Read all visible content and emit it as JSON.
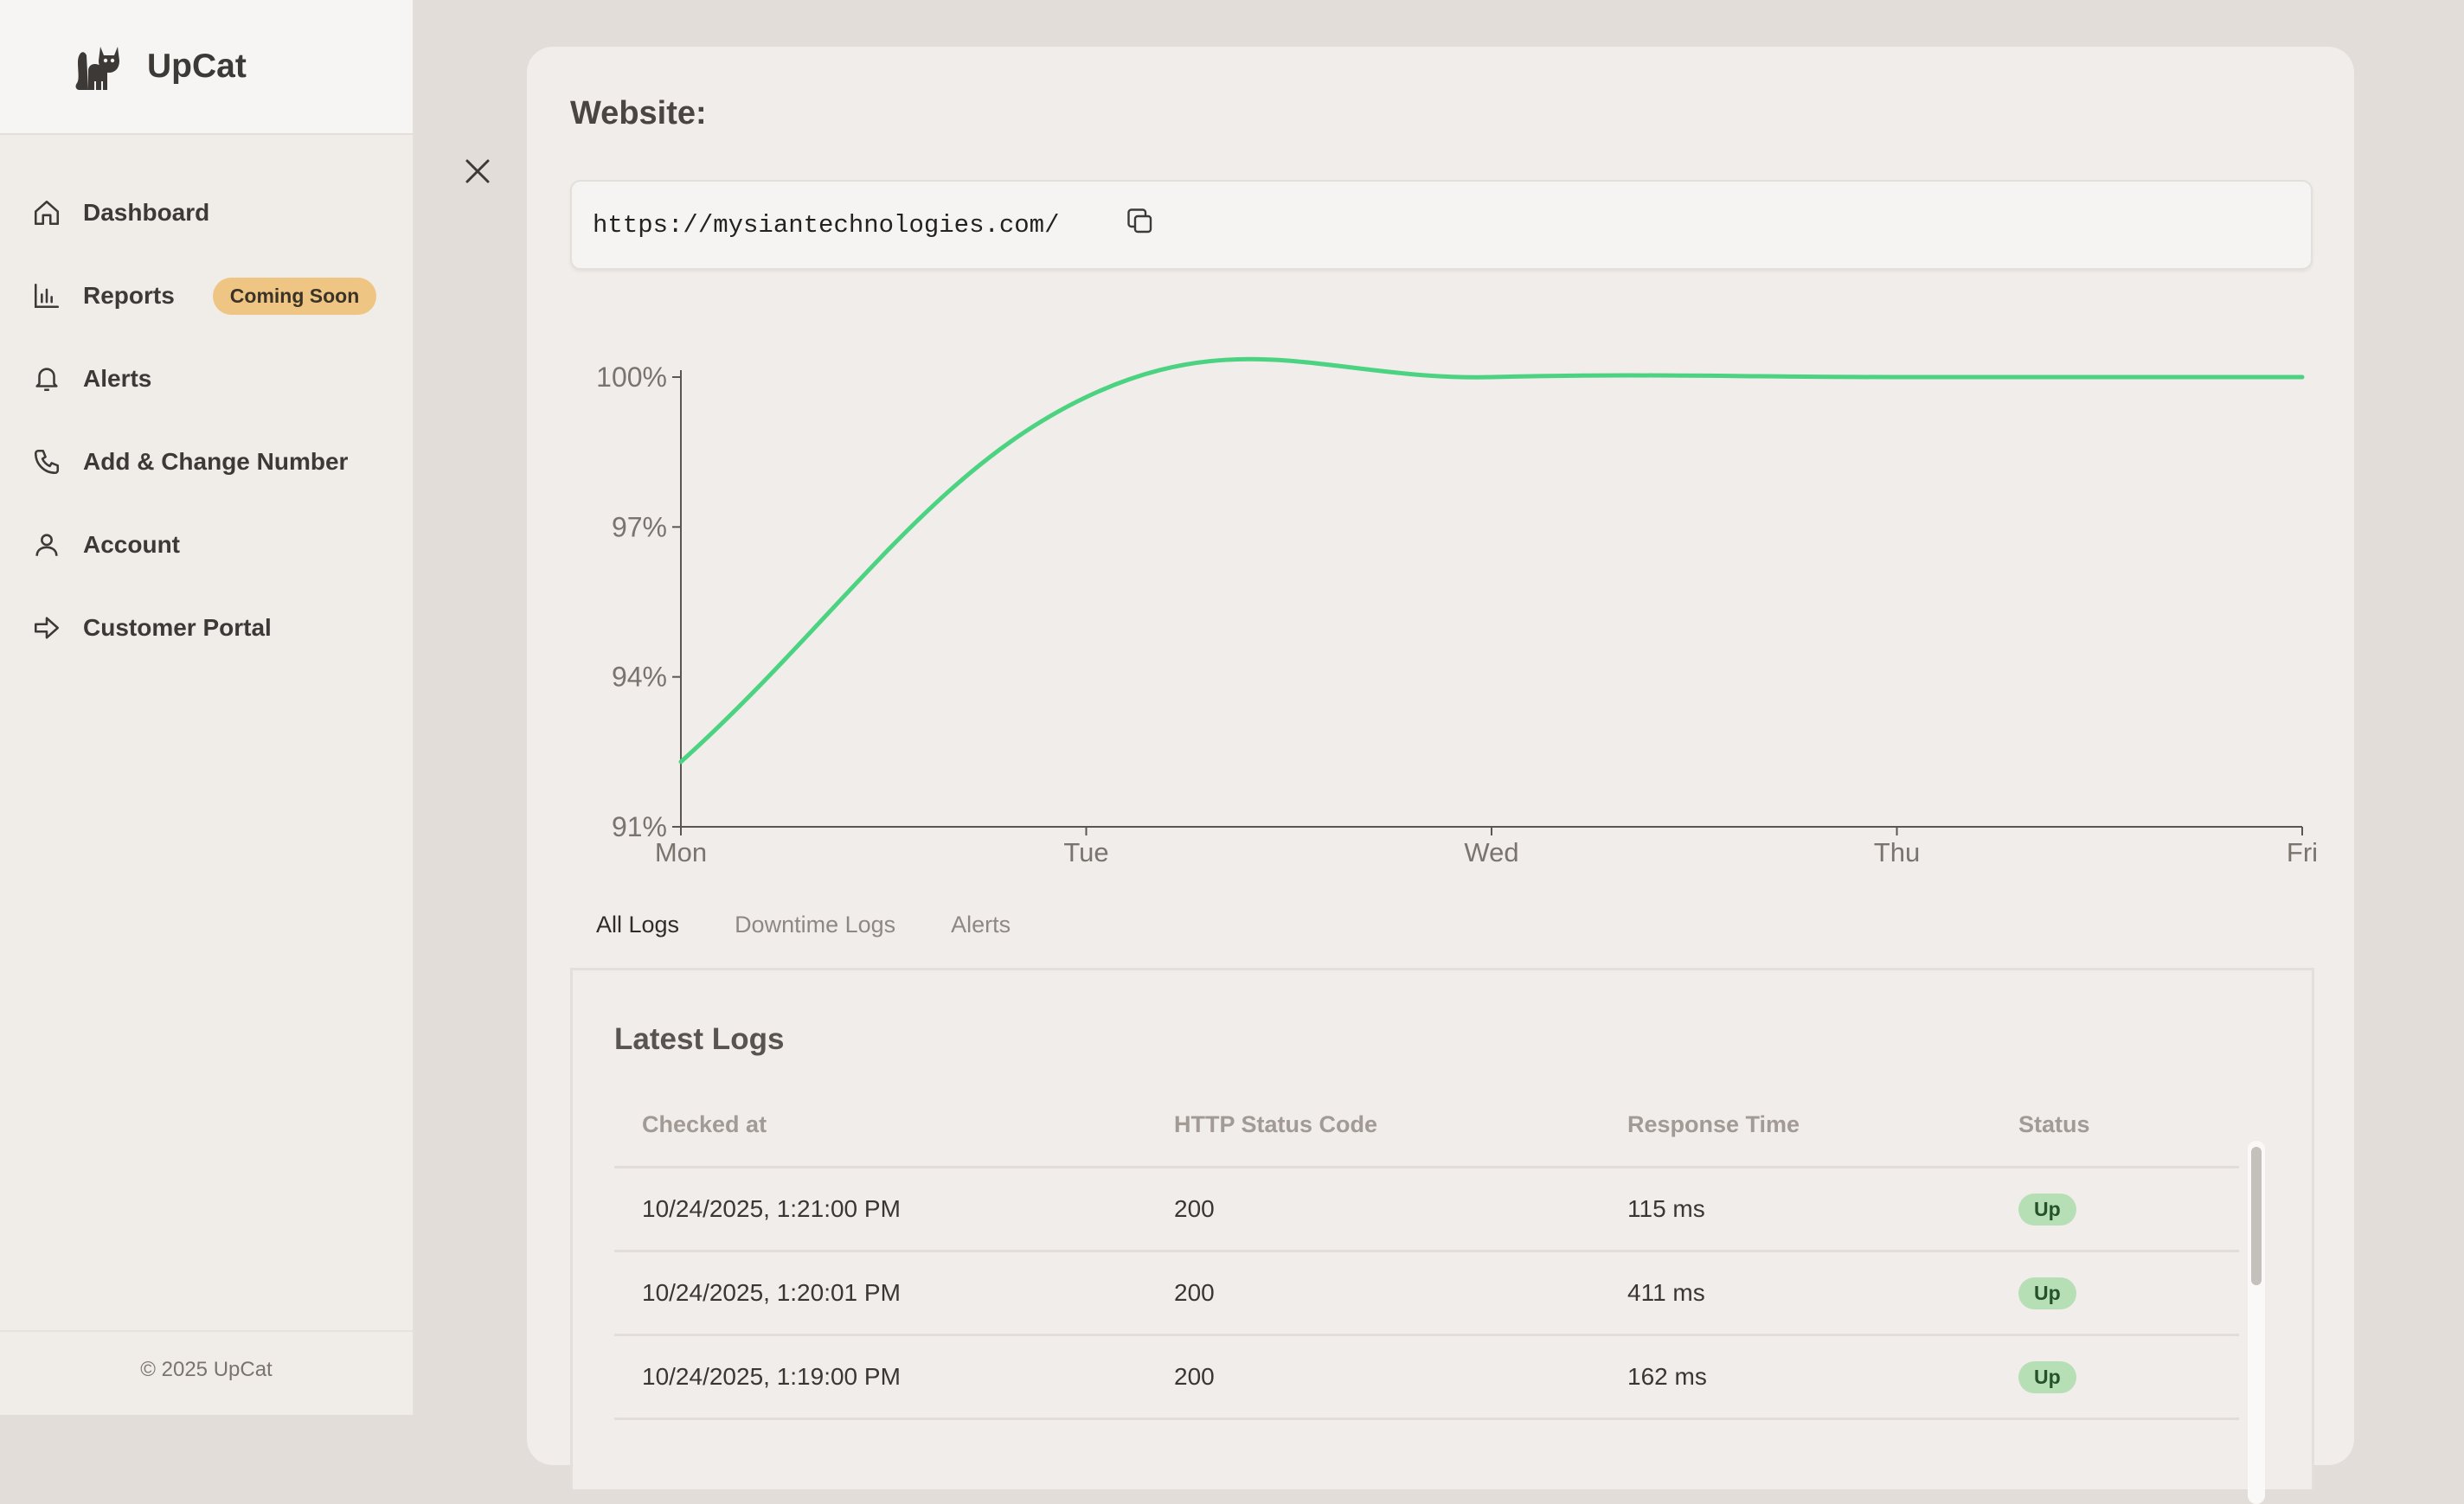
{
  "brand": {
    "name": "UpCat",
    "logo_icon": "cat-logo-icon"
  },
  "sidebar": {
    "items": [
      {
        "label": "Dashboard",
        "icon": "home-icon"
      },
      {
        "label": "Reports",
        "icon": "bar-chart-icon",
        "badge": "Coming Soon"
      },
      {
        "label": "Alerts",
        "icon": "bell-icon"
      },
      {
        "label": "Add & Change Number",
        "icon": "phone-icon"
      },
      {
        "label": "Account",
        "icon": "user-icon"
      },
      {
        "label": "Customer Portal",
        "icon": "arrow-right-icon"
      }
    ],
    "footer": "© 2025 UpCat"
  },
  "panel": {
    "title": "Website:",
    "url": "https://mysiantechnologies.com/",
    "close_icon": "close-icon",
    "copy_icon": "copy-icon"
  },
  "chart_data": {
    "type": "line",
    "x": [
      "Mon",
      "Tue",
      "Wed",
      "Thu",
      "Fri"
    ],
    "series": [
      {
        "values": [
          92.3,
          99.6,
          100,
          100,
          100
        ]
      }
    ],
    "yticks": [
      "91%",
      "94%",
      "97%",
      "100%"
    ],
    "ylim": [
      91,
      100
    ],
    "color": "#4cd381",
    "grid": false
  },
  "tabs": [
    {
      "label": "All Logs",
      "active": true
    },
    {
      "label": "Downtime Logs",
      "active": false
    },
    {
      "label": "Alerts",
      "active": false
    }
  ],
  "logs": {
    "title": "Latest Logs",
    "columns": [
      "Checked at",
      "HTTP Status Code",
      "Response Time",
      "Status"
    ],
    "rows": [
      {
        "checked_at": "10/24/2025, 1:21:00 PM",
        "code": "200",
        "response": "115 ms",
        "status": "Up"
      },
      {
        "checked_at": "10/24/2025, 1:20:01 PM",
        "code": "200",
        "response": "411 ms",
        "status": "Up"
      },
      {
        "checked_at": "10/24/2025, 1:19:00 PM",
        "code": "200",
        "response": "162 ms",
        "status": "Up"
      }
    ]
  },
  "colors": {
    "accent": "#4cd381",
    "badge": "#eec582",
    "status_up": "#b7dfb6"
  }
}
